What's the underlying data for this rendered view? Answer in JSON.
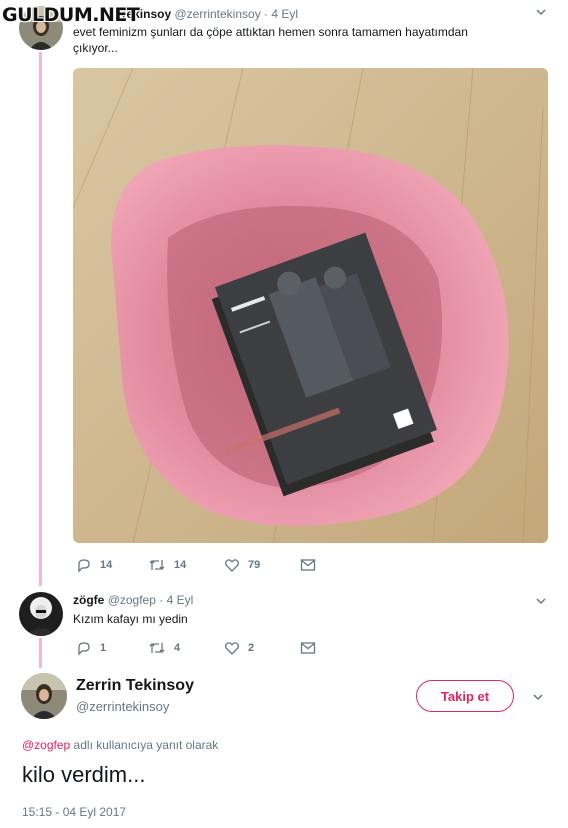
{
  "watermark": "GULDUM.NET",
  "colors": {
    "accent": "#e0245e",
    "thread_line": "#f2b8d3",
    "muted": "#657786"
  },
  "tweet1": {
    "username": "Tekinsoy",
    "handle": "@zerrintekinsoy",
    "separator": "·",
    "date": "4 Eyl",
    "text_line1": "evet feminizm şunları da çöpe attıktan hemen sonra tamamen hayatımdan",
    "text_line2": "çıkıyor...",
    "photo_book_title": "Cinsiyet Belası",
    "photo_book_author": "Judith Butler",
    "photo_book_subtitle": "FEMİNİZM VE KİMLİĞİN ALTÜST",
    "photo_publisher": "metis",
    "actions": {
      "reply_count": "14",
      "retweet_count": "14",
      "like_count": "79"
    }
  },
  "tweet2": {
    "username": "zögfe",
    "handle": "@zogfep",
    "separator": "·",
    "date": "4 Eyl",
    "text": "Kızım kafayı mı yedin",
    "actions": {
      "reply_count": "1",
      "retweet_count": "4",
      "like_count": "2"
    }
  },
  "focus": {
    "display_name": "Zerrin Tekinsoy",
    "handle": "@zerrintekinsoy",
    "follow_label": "Takip et",
    "reply_to_handle": "@zogfep",
    "reply_to_suffix": " adlı kullanıcıya yanıt olarak",
    "text": "kilo verdim...",
    "timestamp": "15:15 - 04 Eyl 2017"
  }
}
